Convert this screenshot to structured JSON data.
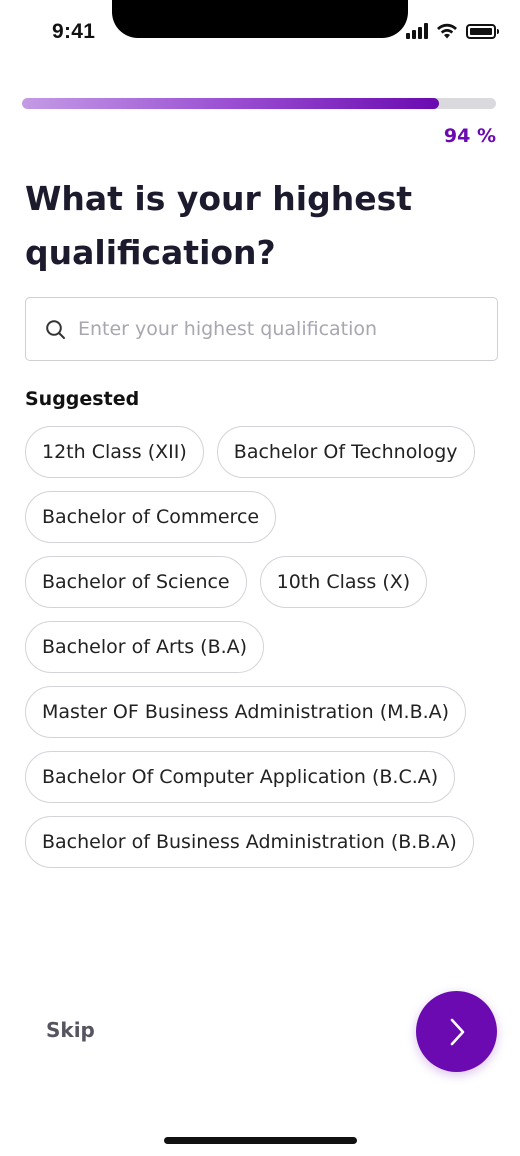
{
  "status_bar": {
    "time": "9:41",
    "icons": [
      "signal-icon",
      "wifi-icon",
      "battery-icon"
    ]
  },
  "progress": {
    "percent": 94,
    "label": "94 %"
  },
  "question": {
    "title": "What is your highest qualification?"
  },
  "search": {
    "icon": "search-icon",
    "placeholder": "Enter your highest qualification",
    "value": ""
  },
  "suggested": {
    "label": "Suggested",
    "items": [
      "12th Class (XII)",
      "Bachelor Of Technology",
      "Bachelor of Commerce",
      "Bachelor of Science",
      "10th Class (X)",
      "Bachelor of Arts (B.A)",
      "Master OF Business Administration (M.B.A)",
      "Bachelor Of Computer Application (B.C.A)",
      "Bachelor of Business Administration (B.B.A)"
    ]
  },
  "footer": {
    "skip_label": "Skip",
    "next_icon": "chevron-right-icon"
  },
  "colors": {
    "accent": "#6a0ab0",
    "progress_start": "#c49be6",
    "track": "#d9d9de",
    "text": "#1c1b2e"
  }
}
